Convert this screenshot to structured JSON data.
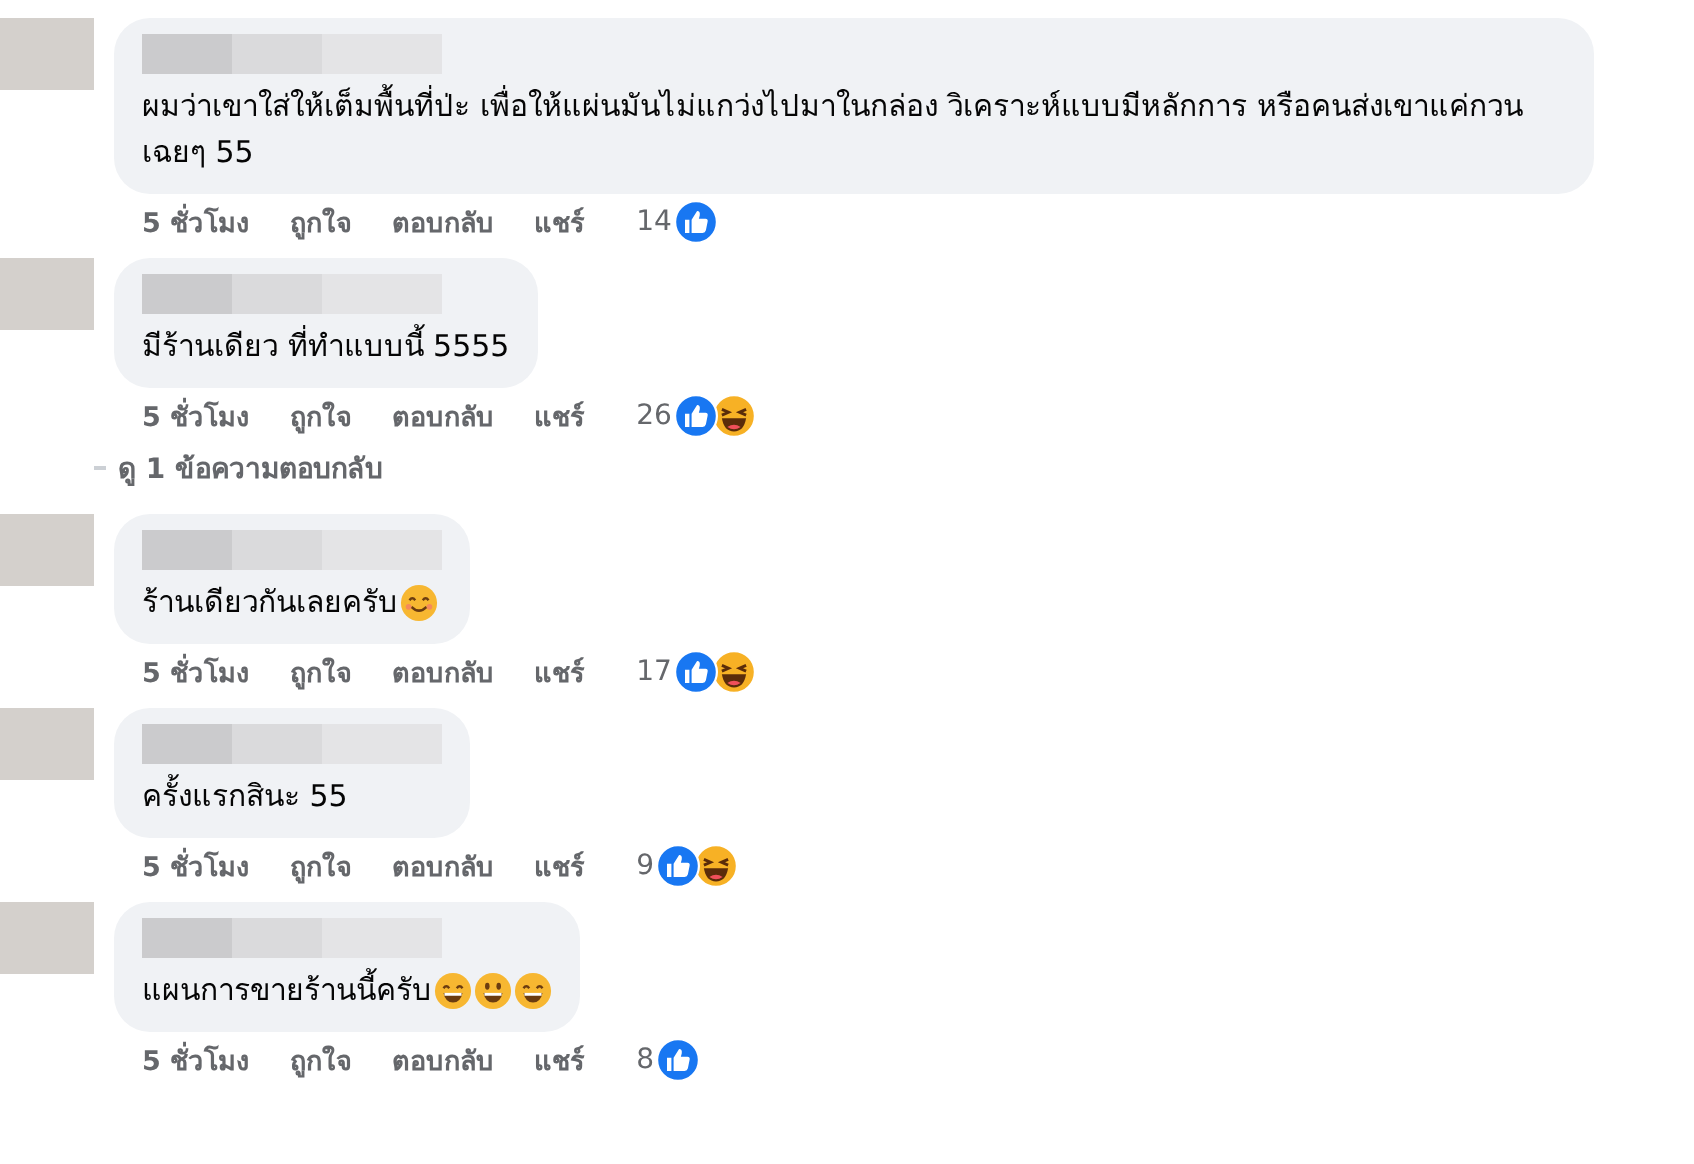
{
  "comments": [
    {
      "text": "ผมว่าเขาใส่ให้เต็มพื้นที่ป่ะ เพื่อให้แผ่นมันไม่แกว่งไปมาในกล่อง วิเคราะห์แบบมีหลักการ หรือคนส่งเขาแค่กวนเฉยๆ 55",
      "time": "5 ชั่วโมง",
      "actions": [
        "ถูกใจ",
        "ตอบกลับ",
        "แชร์"
      ],
      "reaction_count": "14",
      "reactions": [
        {
          "kind": "like"
        }
      ]
    },
    {
      "text": "มีร้านเดียว ที่ทำแบบนี้ 5555",
      "time": "5 ชั่วโมง",
      "actions": [
        "ถูกใจ",
        "ตอบกลับ",
        "แชร์"
      ],
      "reaction_count": "26",
      "reactions": [
        {
          "kind": "like"
        },
        {
          "kind": "haha"
        }
      ],
      "view_replies": "ดู 1 ข้อความตอบกลับ"
    },
    {
      "text": "ร้านเดียวกันเลยครับ",
      "emojis": [
        {
          "kind": "smile"
        }
      ],
      "time": "5 ชั่วโมง",
      "actions": [
        "ถูกใจ",
        "ตอบกลับ",
        "แชร์"
      ],
      "reaction_count": "17",
      "reactions": [
        {
          "kind": "like"
        },
        {
          "kind": "haha"
        }
      ]
    },
    {
      "text": "ครั้งแรกสินะ 55",
      "time": "5 ชั่วโมง",
      "actions": [
        "ถูกใจ",
        "ตอบกลับ",
        "แชร์"
      ],
      "reaction_count": "9",
      "reactions": [
        {
          "kind": "like"
        },
        {
          "kind": "haha"
        }
      ]
    },
    {
      "text": "แผนการขายร้านนี้ครับ",
      "emojis": [
        {
          "kind": "grin"
        },
        {
          "kind": "smiley"
        },
        {
          "kind": "grin"
        }
      ],
      "time": "5 ชั่วโมง",
      "actions": [
        "ถูกใจ",
        "ตอบกลับ",
        "แชร์"
      ],
      "reaction_count": "8",
      "reactions": [
        {
          "kind": "like"
        }
      ]
    }
  ]
}
